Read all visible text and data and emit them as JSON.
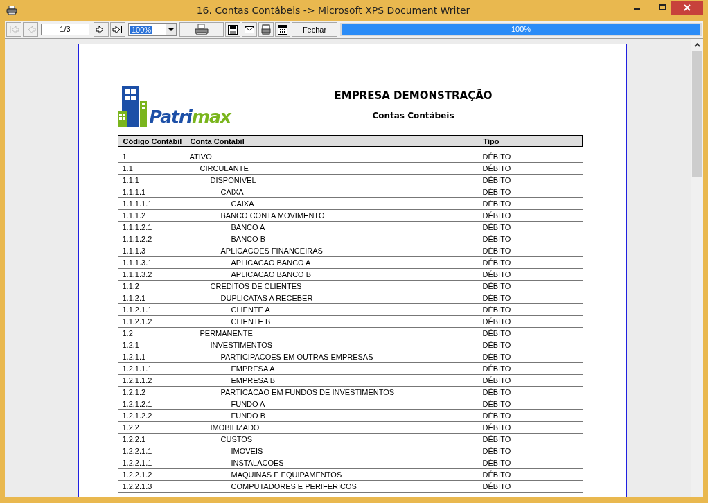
{
  "window": {
    "title": "16. Contas Contábeis -> Microsoft XPS Document Writer"
  },
  "toolbar": {
    "nav_buttons": [
      {
        "kind": "first",
        "disabled": true
      },
      {
        "kind": "prev",
        "disabled": true
      }
    ],
    "page_field": {
      "value": "1/3"
    },
    "next_buttons": [
      {
        "kind": "next",
        "disabled": false
      },
      {
        "kind": "last",
        "disabled": false
      }
    ],
    "zoom": {
      "value": "100%"
    },
    "close_button": "Fechar",
    "progress": {
      "level": 1,
      "reading": "100%"
    }
  },
  "report": {
    "logo": {
      "part_1": "Patri",
      "part_2": "max"
    },
    "company": "EMPRESA DEMONSTRAÇÃO",
    "title": "Contas Contábeis",
    "columns": [
      "Código Contábil",
      "Conta Contábil",
      "Tipo"
    ],
    "rows": [
      {
        "code": "1",
        "name": "ATIVO",
        "type": "DÉBITO",
        "children": [
          {
            "code": "1.1",
            "name": "CIRCULANTE",
            "type": "DÉBITO",
            "children": [
              {
                "code": "1.1.1",
                "name": "DISPONIVEL",
                "type": "DÉBITO",
                "children": [
                  {
                    "code": "1.1.1.1",
                    "name": "CAIXA",
                    "type": "DÉBITO",
                    "children": [
                      {
                        "code": "1.1.1.1.1",
                        "name": "CAIXA",
                        "type": "DÉBITO"
                      }
                    ]
                  },
                  {
                    "code": "1.1.1.2",
                    "name": "BANCO CONTA MOVIMENTO",
                    "type": "DÉBITO",
                    "children": [
                      {
                        "code": "1.1.1.2.1",
                        "name": "BANCO A",
                        "type": "DÉBITO"
                      },
                      {
                        "code": "1.1.1.2.2",
                        "name": "BANCO B",
                        "type": "DÉBITO"
                      }
                    ]
                  },
                  {
                    "code": "1.1.1.3",
                    "name": "APLICACOES FINANCEIRAS",
                    "type": "DÉBITO",
                    "children": [
                      {
                        "code": "1.1.1.3.1",
                        "name": "APLICACAO BANCO A",
                        "type": "DÉBITO"
                      },
                      {
                        "code": "1.1.1.3.2",
                        "name": "APLICACAO BANCO B",
                        "type": "DÉBITO"
                      }
                    ]
                  }
                ]
              },
              {
                "code": "1.1.2",
                "name": "CREDITOS DE CLIENTES",
                "type": "DÉBITO",
                "children": [
                  {
                    "code": "1.1.2.1",
                    "name": "DUPLICATAS A RECEBER",
                    "type": "DÉBITO",
                    "children": [
                      {
                        "code": "1.1.2.1.1",
                        "name": "CLIENTE A",
                        "type": "DÉBITO"
                      },
                      {
                        "code": "1.1.2.1.2",
                        "name": "CLIENTE B",
                        "type": "DÉBITO"
                      }
                    ]
                  }
                ]
              }
            ]
          },
          {
            "code": "1.2",
            "name": "PERMANENTE",
            "type": "DÉBITO",
            "children": [
              {
                "code": "1.2.1",
                "name": "INVESTIMENTOS",
                "type": "DÉBITO",
                "children": [
                  {
                    "code": "1.2.1.1",
                    "name": "PARTICIPACOES EM OUTRAS EMPRESAS",
                    "type": "DÉBITO",
                    "children": [
                      {
                        "code": "1.2.1.1.1",
                        "name": "EMPRESA A",
                        "type": "DÉBITO"
                      },
                      {
                        "code": "1.2.1.1.2",
                        "name": "EMPRESA B",
                        "type": "DÉBITO"
                      }
                    ]
                  },
                  {
                    "code": "1.2.1.2",
                    "name": "PARTICACAO EM FUNDOS DE INVESTIMENTOS",
                    "type": "DÉBITO",
                    "children": [
                      {
                        "code": "1.2.1.2.1",
                        "name": "FUNDO A",
                        "type": "DÉBITO"
                      },
                      {
                        "code": "1.2.1.2.2",
                        "name": "FUNDO B",
                        "type": "DÉBITO"
                      }
                    ]
                  }
                ]
              },
              {
                "code": "1.2.2",
                "name": "IMOBILIZADO",
                "type": "DÉBITO",
                "children": [
                  {
                    "code": "1.2.2.1",
                    "name": "CUSTOS",
                    "type": "DÉBITO",
                    "children": [
                      {
                        "code": "1.2.2.1.1",
                        "name": "IMOVEIS",
                        "type": "DÉBITO"
                      },
                      {
                        "code": "1.2.2.1.1",
                        "name": "INSTALACOES",
                        "type": "DÉBITO"
                      },
                      {
                        "code": "1.2.2.1.2",
                        "name": "MAQUINAS E EQUIPAMENTOS",
                        "type": "DÉBITO"
                      },
                      {
                        "code": "1.2.2.1.3",
                        "name": "COMPUTADORES E PERIFERICOS",
                        "type": "DÉBITO"
                      }
                    ]
                  }
                ]
              }
            ]
          }
        ]
      }
    ]
  }
}
